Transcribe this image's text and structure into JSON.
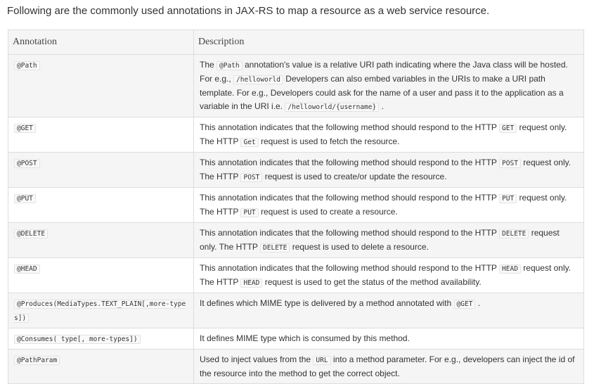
{
  "intro": "Following are the commonly used annotations in JAX-RS to map a resource as a web service resource.",
  "table": {
    "headers": [
      "Annotation",
      "Description"
    ],
    "rows": [
      {
        "annotation": "@Path",
        "d": [
          "The ",
          "@Path",
          " annotation's value is a relative URI path indicating where the Java class will be hosted. For e.g., ",
          "/helloworld",
          " Developers can also embed variables in the URIs to make a URI path template. For e.g., Developers could ask for the name of a user and pass it to the application as a variable in the URI i.e. ",
          "/helloworld/{username}",
          " ."
        ]
      },
      {
        "annotation": "@GET",
        "d": [
          "This annotation indicates that the following method should respond to the HTTP ",
          "GET",
          " request only. The HTTP ",
          "Get",
          " request is used to fetch the resource."
        ]
      },
      {
        "annotation": "@POST",
        "d": [
          "This annotation indicates that the following method should respond to the HTTP ",
          "POST",
          " request only. The HTTP ",
          "POST",
          " request is used to create/or update the resource."
        ]
      },
      {
        "annotation": "@PUT",
        "d": [
          "This annotation indicates that the following method should respond to the HTTP ",
          "PUT",
          " request only. The HTTP ",
          "PUT",
          " request is used to create a resource."
        ]
      },
      {
        "annotation": "@DELETE",
        "d": [
          "This annotation indicates that the following method should respond to the HTTP ",
          "DELETE",
          " request only. The HTTP ",
          "DELETE",
          " request is used to delete a resource."
        ]
      },
      {
        "annotation": "@HEAD",
        "d": [
          "This annotation indicates that the following method should respond to the HTTP ",
          "HEAD",
          " request only. The HTTP ",
          "HEAD",
          " request is used to get the status of the method availability."
        ]
      },
      {
        "annotation": "@Produces(MediaTypes.TEXT_PLAIN[,more-types])",
        "d": [
          "It defines which MIME type is delivered by a method annotated with ",
          "@GET",
          " ."
        ]
      },
      {
        "annotation": "@Consumes( type[, more-types])",
        "d": [
          "It defines MIME type which is consumed by this method."
        ]
      },
      {
        "annotation": "@PathParam",
        "d": [
          "Used to inject values from the ",
          "URL",
          " into a method parameter. For e.g., developers can inject the id of the resource into the method to get the correct object."
        ]
      }
    ]
  }
}
